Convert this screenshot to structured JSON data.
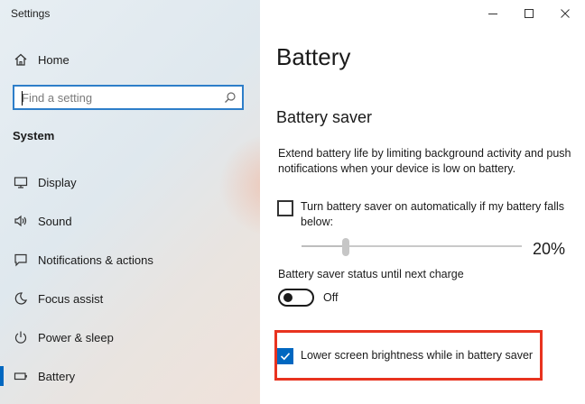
{
  "window": {
    "title": "Settings",
    "controls": {
      "minimize": "minimize-icon",
      "maximize": "maximize-icon",
      "close": "close-icon"
    }
  },
  "sidebar": {
    "home": {
      "label": "Home",
      "icon": "home-icon"
    },
    "search": {
      "placeholder": "Find a setting",
      "value": "",
      "icon": "search-icon"
    },
    "section": "System",
    "items": [
      {
        "label": "Display",
        "icon": "display-icon"
      },
      {
        "label": "Sound",
        "icon": "sound-icon"
      },
      {
        "label": "Notifications & actions",
        "icon": "notifications-icon"
      },
      {
        "label": "Focus assist",
        "icon": "focus-assist-icon"
      },
      {
        "label": "Power & sleep",
        "icon": "power-icon"
      },
      {
        "label": "Battery",
        "icon": "battery-icon",
        "selected": true
      }
    ]
  },
  "main": {
    "title": "Battery",
    "battery_saver": {
      "heading": "Battery saver",
      "description": "Extend battery life by limiting background activity and push notifications when your device is low on battery.",
      "auto_checkbox": {
        "label": "Turn battery saver on automatically if my battery falls below:",
        "checked": false
      },
      "threshold": {
        "value_label": "20%",
        "fraction": 0.2
      },
      "status": {
        "label": "Battery saver status until next charge",
        "state_label": "Off",
        "on": false
      },
      "brightness_checkbox": {
        "label": "Lower screen brightness while in battery saver",
        "checked": true
      }
    }
  },
  "colors": {
    "accent": "#0067c0",
    "highlight": "#e8331f"
  }
}
